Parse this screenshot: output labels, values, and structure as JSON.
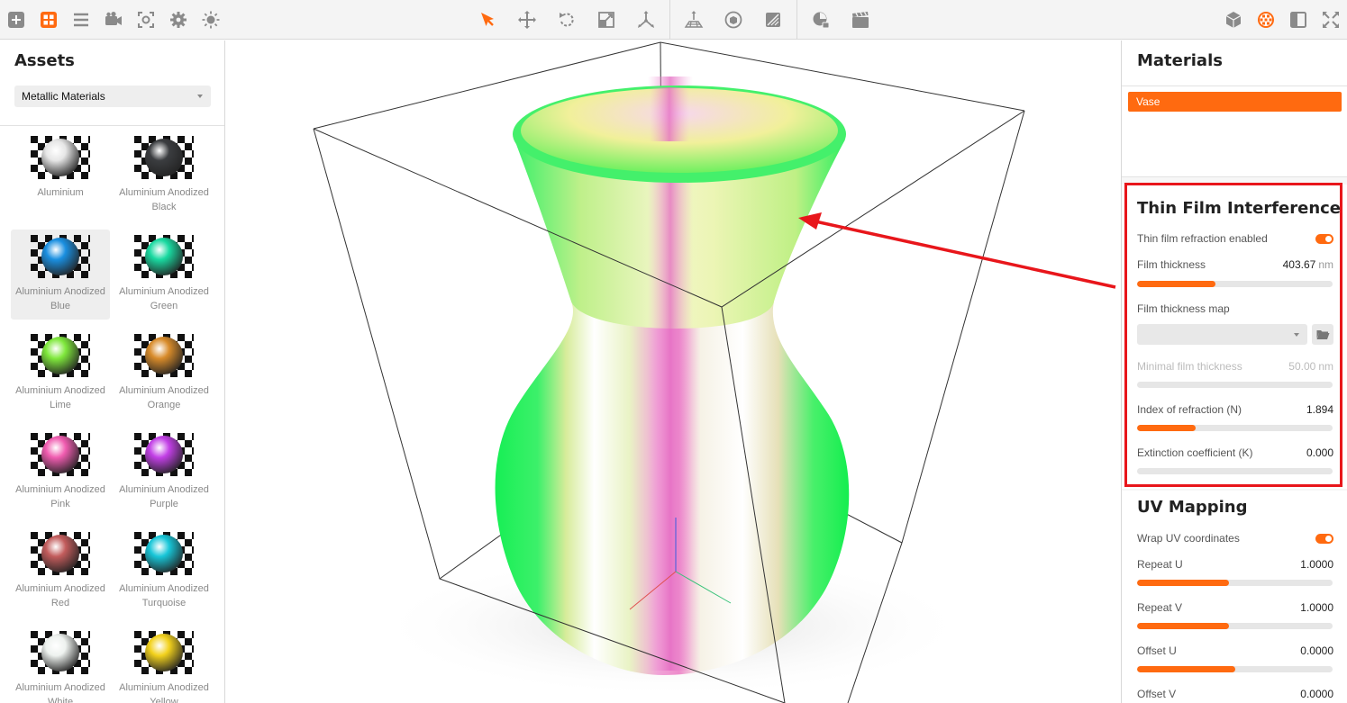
{
  "toolbar": {
    "left_icons": [
      "add-icon",
      "assets-grid-icon",
      "list-icon",
      "camera-icon",
      "focus-icon",
      "gear-icon",
      "light-icon"
    ],
    "center_icons": [
      "select-arrow-icon",
      "move-icon",
      "rotate-icon",
      "scale-icon",
      "pivot-icon"
    ],
    "scene_icons": [
      "ground-icon",
      "environment-icon",
      "material-preview-icon"
    ],
    "render_icons": [
      "render-icon",
      "animation-icon"
    ],
    "right_icons": [
      "scene-objects-icon",
      "materials-icon",
      "layout-icon",
      "fullscreen-icon"
    ],
    "accent": "#ff6a10"
  },
  "assets_panel": {
    "title": "Assets",
    "category": "Metallic Materials",
    "items": [
      {
        "label": "Aluminium",
        "color": "#e6e6e6",
        "selected": false
      },
      {
        "label": "Aluminium Anodized Black",
        "color": "#3b3d40",
        "selected": false
      },
      {
        "label": "Aluminium Anodized Blue",
        "color": "#1a8fe0",
        "selected": true
      },
      {
        "label": "Aluminium Anodized Green",
        "color": "#19d9a0",
        "selected": false
      },
      {
        "label": "Aluminium Anodized Lime",
        "color": "#7fe83c",
        "selected": false
      },
      {
        "label": "Aluminium Anodized Orange",
        "color": "#d88b2a",
        "selected": false
      },
      {
        "label": "Aluminium Anodized Pink",
        "color": "#f05cb0",
        "selected": false
      },
      {
        "label": "Aluminium Anodized Purple",
        "color": "#c23fe6",
        "selected": false
      },
      {
        "label": "Aluminium Anodized Red",
        "color": "#c25c5c",
        "selected": false
      },
      {
        "label": "Aluminium Anodized Turquoise",
        "color": "#17c6d8",
        "selected": false
      },
      {
        "label": "Aluminium Anodized White",
        "color": "#eef2ef",
        "selected": false
      },
      {
        "label": "Aluminium Anodized Yellow",
        "color": "#f2d11c",
        "selected": false
      }
    ]
  },
  "materials_panel": {
    "title": "Materials",
    "items": [
      "Vase"
    ],
    "selected": "Vase"
  },
  "thin_film": {
    "title": "Thin Film Interference",
    "enabled_label": "Thin film refraction enabled",
    "enabled": true,
    "thickness_label": "Film thickness",
    "thickness_value": "403.67",
    "thickness_unit": "nm",
    "thickness_fraction": 0.4,
    "map_label": "Film thickness map",
    "min_label": "Minimal film thickness",
    "min_value": "50.00",
    "min_unit": "nm",
    "min_fraction": 0.0,
    "ior_label": "Index of refraction (N)",
    "ior_value": "1.894",
    "ior_fraction": 0.3,
    "extinction_label": "Extinction coefficient (K)",
    "extinction_value": "0.000",
    "extinction_fraction": 0.0
  },
  "uv_mapping": {
    "title": "UV Mapping",
    "wrap_label": "Wrap UV coordinates",
    "wrap_enabled": true,
    "repeat_u_label": "Repeat U",
    "repeat_u_value": "1.0000",
    "repeat_u_fraction": 0.47,
    "repeat_v_label": "Repeat V",
    "repeat_v_value": "1.0000",
    "repeat_v_fraction": 0.47,
    "offset_u_label": "Offset U",
    "offset_u_value": "0.0000",
    "offset_u_fraction": 0.5,
    "offset_v_label": "Offset V",
    "offset_v_value": "0.0000"
  },
  "annotation": {
    "highlight_color": "#e8161b"
  }
}
